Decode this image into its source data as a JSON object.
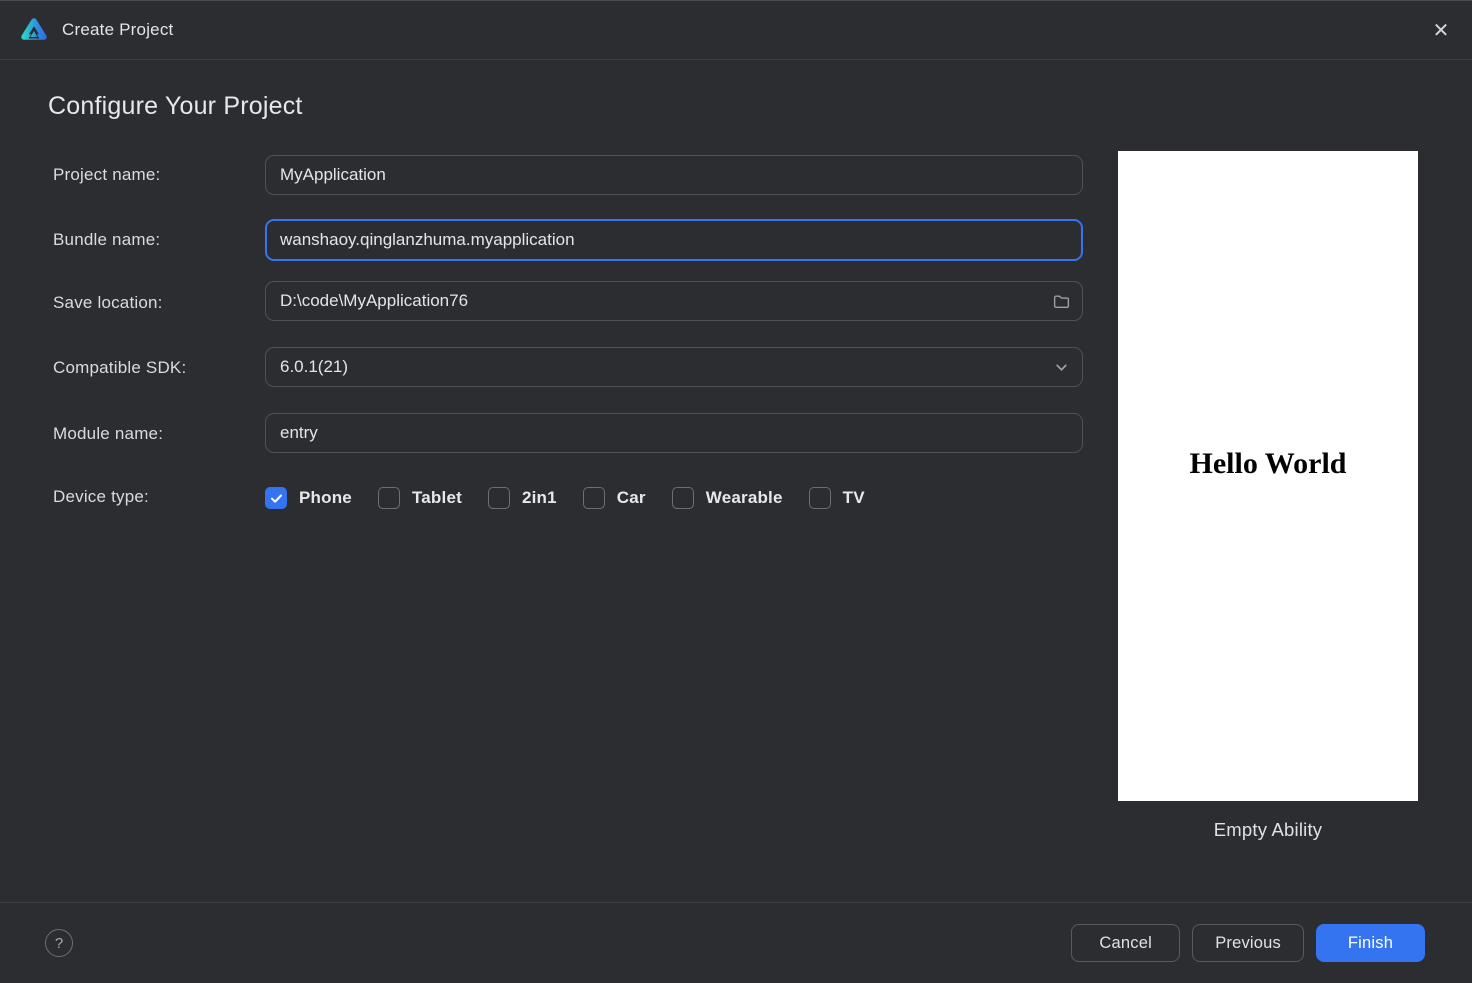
{
  "window": {
    "title": "Create Project",
    "close_glyph": "✕"
  },
  "page": {
    "heading": "Configure Your Project"
  },
  "form": {
    "fields": [
      {
        "label": "Project name:",
        "value": "MyApplication",
        "type": "text"
      },
      {
        "label": "Bundle name:",
        "value": "wanshaoy.qinglanzhuma.myapplication",
        "type": "text",
        "focused": true
      },
      {
        "label": "Save location:",
        "value": "D:\\code\\MyApplication76",
        "type": "text",
        "trailing_icon": "folder-icon"
      },
      {
        "label": "Compatible SDK:",
        "value": "6.0.1(21)",
        "type": "select",
        "trailing_icon": "chevron-down-icon"
      },
      {
        "label": "Module name:",
        "value": "entry",
        "type": "text"
      }
    ],
    "device_type": {
      "label": "Device type:",
      "options": [
        {
          "label": "Phone",
          "checked": true
        },
        {
          "label": "Tablet",
          "checked": false
        },
        {
          "label": "2in1",
          "checked": false
        },
        {
          "label": "Car",
          "checked": false
        },
        {
          "label": "Wearable",
          "checked": false
        },
        {
          "label": "TV",
          "checked": false
        }
      ]
    }
  },
  "preview": {
    "content": "Hello World",
    "caption": "Empty Ability"
  },
  "footer": {
    "help_glyph": "?",
    "cancel_label": "Cancel",
    "previous_label": "Previous",
    "finish_label": "Finish"
  },
  "colors": {
    "accent": "#3574f0",
    "background": "#2b2d31",
    "input_border": "#4e5157",
    "separator": "#3e4044",
    "preview_background": "#ffffff"
  }
}
